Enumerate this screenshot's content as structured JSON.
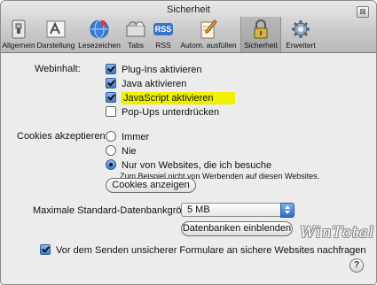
{
  "window": {
    "title": "Sicherheit",
    "close_glyph": "⊠"
  },
  "toolbar": {
    "items": [
      {
        "label": "Allgemein",
        "icon": "general-switch-icon"
      },
      {
        "label": "Darstellung",
        "icon": "appearance-font-icon"
      },
      {
        "label": "Lesezeichen",
        "icon": "bookmarks-globe-icon"
      },
      {
        "label": "Tabs",
        "icon": "tabs-icon"
      },
      {
        "label": "RSS",
        "icon": "rss-icon",
        "badge": "RSS"
      },
      {
        "label": "Autom. ausfüllen",
        "icon": "autofill-pencil-icon"
      },
      {
        "label": "Sicherheit",
        "icon": "lock-icon",
        "active": true
      },
      {
        "label": "Erweitert",
        "icon": "gear-icon"
      }
    ]
  },
  "webcontent": {
    "label": "Webinhalt:",
    "options": [
      {
        "label": "Plug-Ins aktivieren",
        "checked": true
      },
      {
        "label": "Java aktivieren",
        "checked": true
      },
      {
        "label": "JavaScript aktivieren",
        "checked": true,
        "highlight": "#f0f000"
      },
      {
        "label": "Pop-Ups unterdrücken",
        "checked": false
      }
    ]
  },
  "cookies": {
    "label": "Cookies akzeptieren:",
    "options": [
      {
        "label": "Immer",
        "selected": false
      },
      {
        "label": "Nie",
        "selected": false
      },
      {
        "label": "Nur von Websites, die ich besuche",
        "selected": true
      }
    ],
    "hint": "Zum Beispiel nicht von Werbenden auf diesen Websites.",
    "show_button": "Cookies anzeigen"
  },
  "database": {
    "label": "Maximale Standard-Datenbankgröße:",
    "value": "5 MB",
    "show_button": "Datenbanken einblenden"
  },
  "warn_insecure": {
    "label": "Vor dem Senden unsicherer Formulare an sichere Websites nachfragen",
    "checked": true
  },
  "watermark": "WinTotal",
  "help_label": "?"
}
